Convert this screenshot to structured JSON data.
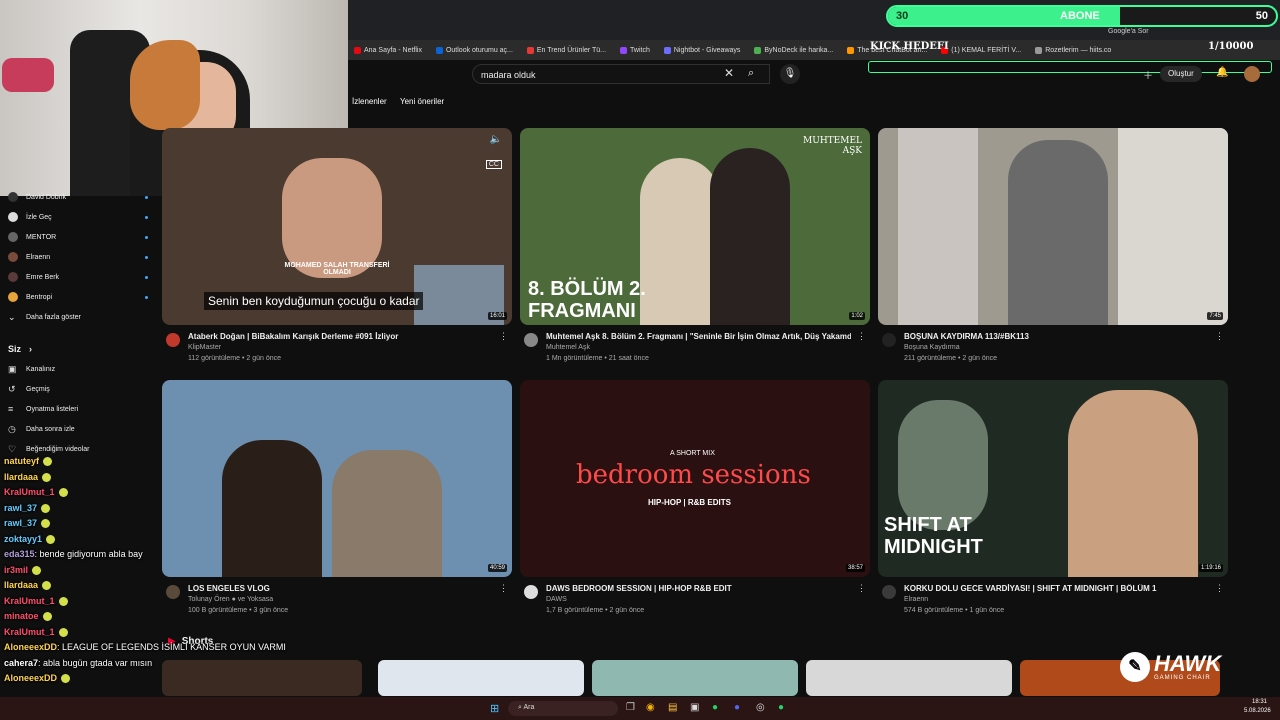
{
  "overlay": {
    "goal_current": "30",
    "goal_label": "ABONE",
    "goal_target": "50",
    "kick_goal": "KICK HEDEFI",
    "kick_value": "1/10000",
    "sponsor_brand": "HAWK",
    "sponsor_sub": "GAMING CHAIR"
  },
  "bookmarks": [
    {
      "label": "Ana Sayfa - Netflix",
      "color": "#e50914"
    },
    {
      "label": "Outlook oturumu aç...",
      "color": "#0a64d8"
    },
    {
      "label": "En Trend Ürünler Tü...",
      "color": "#e53935"
    },
    {
      "label": "Twitch",
      "color": "#9146ff"
    },
    {
      "label": "Nightbot - Giveaways",
      "color": "#6c6cff"
    },
    {
      "label": "ByNoDeck ile harika...",
      "color": "#4caf50"
    },
    {
      "label": "The best ChatBot an...",
      "color": "#ff9800"
    },
    {
      "label": "(1) KEMAL FERİTİ V...",
      "color": "#ff0000"
    },
    {
      "label": "Rozetlerim — hiits.co",
      "color": "#999"
    }
  ],
  "browser": {
    "google_label": "Google'a Sor"
  },
  "search": {
    "query": "madara olduk"
  },
  "chips": [
    "İzlenenler",
    "Yeni öneriler"
  ],
  "header": {
    "create_label": "Oluştur"
  },
  "sidebar": {
    "subscriptions": [
      {
        "label": "David Dobrik"
      },
      {
        "label": "İzle Geç"
      },
      {
        "label": "MENTOR"
      },
      {
        "label": "Elraenn"
      },
      {
        "label": "Emre Berk"
      },
      {
        "label": "Bentropi"
      }
    ],
    "show_more": "Daha fazla göster",
    "you_header": "Siz",
    "you_items": [
      {
        "label": "Kanalınız"
      },
      {
        "label": "Geçmiş"
      },
      {
        "label": "Oynatma listeleri"
      },
      {
        "label": "Daha sonra izle"
      },
      {
        "label": "Beğendiğim videolar"
      }
    ]
  },
  "videos": [
    {
      "title": "Ataberk Doğan | BiBakalım Karışık Derleme #091 İzliyor",
      "channel": "KlipMaster",
      "stats": "112 görüntüleme • 2 gün önce",
      "duration": "16:01",
      "caption": "Senin ben koyduğumun çocuğu o kadar",
      "overlay_text": "MOHAMED SALAH TRANSFERİ OLMADI",
      "color": "#4a3a30"
    },
    {
      "title": "Muhtemel Aşk 8. Bölüm 2. Fragmanı | \"Seninle Bir İşim Olmaz Artık, Düş Yakamdan!\"",
      "channel": "Muhtemel Aşk",
      "stats": "1 Mn görüntüleme • 21 saat önce",
      "duration": "1:02",
      "caption": "8. BÖLÜM 2. FRAGMANI",
      "logo": "MUHTEMEL AŞK",
      "color": "#4c6a3a"
    },
    {
      "title": "BOŞUNA KAYDIRMA 113/#BK113",
      "channel": "Boşuna Kaydırma",
      "stats": "211 görüntüleme • 2 gün önce",
      "duration": "7:45",
      "color": "#9e9a90"
    },
    {
      "title": "LOS ENGELES VLOG",
      "channel": "Tolunay Ören ● ve Yoksasa",
      "stats": "100 B görüntüleme • 3 gün önce",
      "duration": "40:59",
      "color": "#6d8fb0"
    },
    {
      "title": "DAWS BEDROOM SESSION | HIP-HOP R&B EDIT",
      "channel": "DAWS",
      "stats": "1,7 B görüntüleme • 2 gün önce",
      "duration": "38:57",
      "caption": "bedroom sessions",
      "sub": "HIP-HOP | R&B EDITS",
      "kicker": "A SHORT MIX",
      "color": "#2a1010"
    },
    {
      "title": "KORKU DOLU GECE VARDİYASI! | SHIFT AT MIDNIGHT | BÖLÜM 1",
      "channel": "Elraenn",
      "stats": "574 B görüntüleme • 1 gün önce",
      "duration": "1:19:16",
      "caption": "SHIFT AT MIDNIGHT",
      "color": "#1e2a22"
    }
  ],
  "shorts": {
    "label": "Shorts"
  },
  "chat": [
    {
      "user": "natuteyf",
      "msg": "",
      "color": "#ffd54f"
    },
    {
      "user": "llardaaa",
      "msg": "",
      "color": "#ffd54f"
    },
    {
      "user": "KralUmut_1",
      "msg": "",
      "color": "#ff4d6d"
    },
    {
      "user": "rawl_37",
      "msg": "",
      "color": "#66ccff"
    },
    {
      "user": "rawl_37",
      "msg": "",
      "color": "#66ccff"
    },
    {
      "user": "zoktayy1",
      "msg": "",
      "color": "#66ccff"
    },
    {
      "user": "eda315",
      "msg": "bende gidiyorum abla bay",
      "color": "#b39ddb"
    },
    {
      "user": "ir3mil",
      "msg": "",
      "color": "#ff4d6d"
    },
    {
      "user": "llardaaa",
      "msg": "",
      "color": "#ffd54f"
    },
    {
      "user": "KralUmut_1",
      "msg": "",
      "color": "#ff4d6d"
    },
    {
      "user": "minatoe",
      "msg": "",
      "color": "#ff4d6d"
    },
    {
      "user": "KralUmut_1",
      "msg": "",
      "color": "#ff4d6d"
    },
    {
      "user": "AloneeexDD",
      "msg": "LEAGUE OF LEGENDS İSİMLİ KANSER OYUN VARMI",
      "color": "#ffd54f"
    },
    {
      "user": "cahera7",
      "msg": "abla bugün gtada var mısın",
      "color": "#ffffff"
    },
    {
      "user": "AloneeexDD",
      "msg": "",
      "color": "#ffd54f"
    }
  ],
  "taskbar": {
    "search_label": "Ara",
    "time": "18:31",
    "date": "5.08.2026"
  }
}
